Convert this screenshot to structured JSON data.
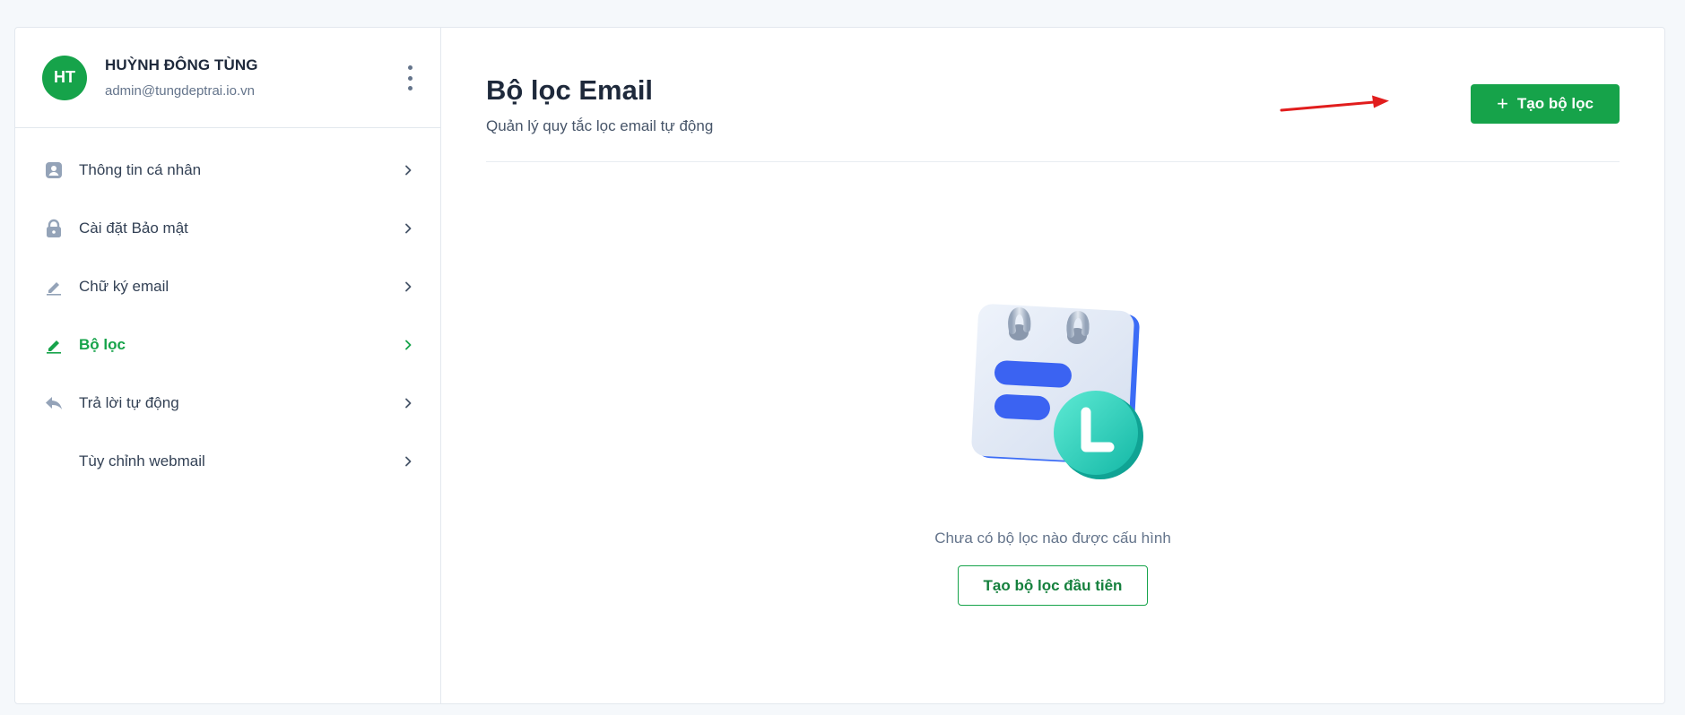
{
  "user": {
    "initials": "HT",
    "name": "HUỲNH ĐÔNG TÙNG",
    "email": "admin@tungdeptrai.io.vn",
    "avatar_color": "#16a34a"
  },
  "sidebar": {
    "items": [
      {
        "label": "Thông tin cá nhân",
        "icon": "user-badge-icon",
        "active": false
      },
      {
        "label": "Cài đặt Bảo mật",
        "icon": "lock-icon",
        "active": false
      },
      {
        "label": "Chữ ký email",
        "icon": "pen-icon",
        "active": false
      },
      {
        "label": "Bộ lọc",
        "icon": "pen-icon",
        "active": true
      },
      {
        "label": "Trả lời tự động",
        "icon": "reply-icon",
        "active": false
      },
      {
        "label": "Tùy chỉnh webmail",
        "icon": "",
        "active": false
      }
    ]
  },
  "main": {
    "title": "Bộ lọc Email",
    "subtitle": "Quản lý quy tắc lọc email tự động",
    "create_button": "Tạo bộ lọc",
    "empty_message": "Chưa có bộ lọc nào được cấu hình",
    "first_button": "Tạo bộ lọc đầu tiên"
  },
  "colors": {
    "accent": "#16a34a",
    "annotation_arrow": "#e11d1d"
  }
}
